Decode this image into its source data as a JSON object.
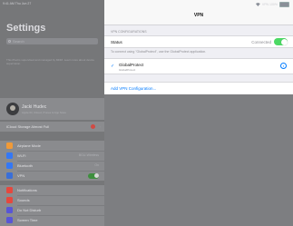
{
  "status_bar": {
    "time": "9:41 AM   Thu Jun 27",
    "right": "VPN 100%"
  },
  "sidebar": {
    "title": "Settings",
    "search_placeholder": "Search",
    "note": "This iPad is supervised and managed by MDM. Learn more about device supervision.",
    "account": {
      "name": "Jacki Hudec",
      "subtitle": "Apple ID, iCloud, iTunes & App Store"
    },
    "storage": {
      "label": "iCloud Storage Almost Full",
      "badge": "1"
    },
    "group1": [
      {
        "label": "Airplane Mode",
        "value": "",
        "color": "#f19a37",
        "icon": "airplane-icon"
      },
      {
        "label": "Wi-Fi",
        "value": "BGU-Wireless",
        "color": "#3478f6",
        "icon": "wifi-icon"
      },
      {
        "label": "Bluetooth",
        "value": "On",
        "color": "#3478f6",
        "icon": "bluetooth-icon"
      },
      {
        "label": "VPN",
        "value": "",
        "color": "#3a6fd8",
        "icon": "vpn-icon"
      }
    ],
    "group2": [
      {
        "label": "Notifications",
        "color": "#e5483e",
        "icon": "notifications-icon"
      },
      {
        "label": "Sounds",
        "color": "#e5483e",
        "icon": "sounds-icon"
      },
      {
        "label": "Do Not Disturb",
        "color": "#5856d6",
        "icon": "moon-icon"
      },
      {
        "label": "Screen Time",
        "color": "#5856d6",
        "icon": "hourglass-icon"
      }
    ]
  },
  "vpn": {
    "title": "VPN",
    "section_header": "VPN CONFIGURATIONS",
    "status_label": "Status",
    "status_value": "Connected",
    "footnote": "To connect using \"GlobalProtect\", use the GlobalProtect application.",
    "config_name": "GlobalProtect",
    "config_sub": "GlobalProtect",
    "add_label": "Add VPN Configuration..."
  },
  "colors": {
    "accent": "#007aff",
    "toggle_on": "#4cd964"
  }
}
